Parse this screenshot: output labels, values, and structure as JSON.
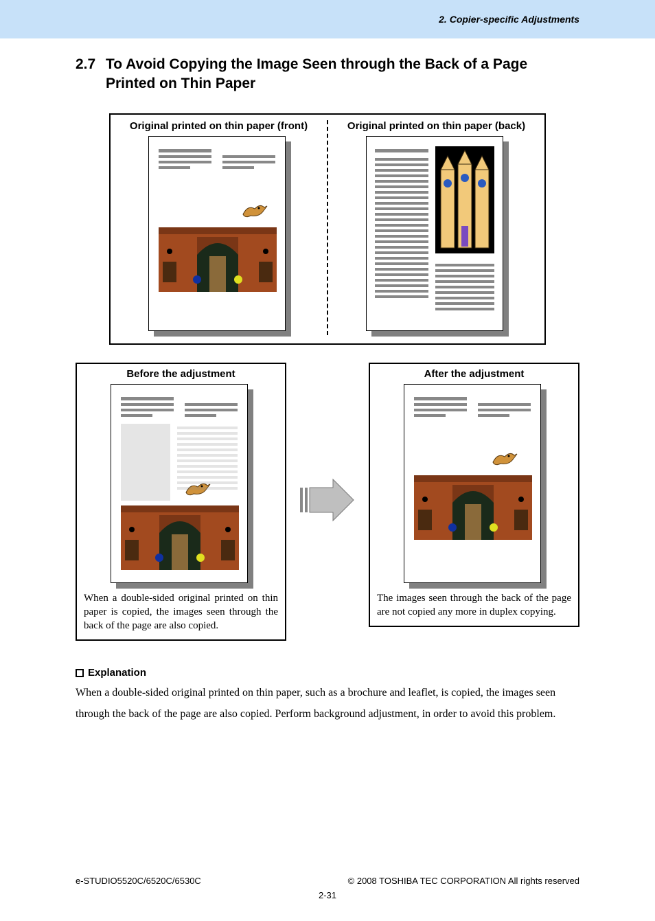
{
  "header": {
    "chapter": "2. Copier-specific Adjustments"
  },
  "section": {
    "number": "2.7",
    "title": "To Avoid Copying the Image Seen through the Back of a Page Printed on Thin Paper"
  },
  "top": {
    "front_caption": "Original printed on thin paper (front)",
    "back_caption": "Original printed on thin paper (back)"
  },
  "compare": {
    "before_caption": "Before the adjustment",
    "before_text": "When a double-sided original printed on thin paper is copied, the images seen through the back of the page are also copied.",
    "after_caption": "After the adjustment",
    "after_text": "The images seen through the back of the page are not copied any more in duplex copying."
  },
  "explanation": {
    "heading": "Explanation",
    "body": "When a double-sided original printed on thin paper, such as a brochure and leaflet, is copied, the images seen through the back of the page are also copied.  Perform background adjustment, in order to avoid this problem."
  },
  "footer": {
    "model": "e-STUDIO5520C/6520C/6530C",
    "copyright": "© 2008 TOSHIBA TEC CORPORATION All rights reserved",
    "page": "2-31"
  }
}
